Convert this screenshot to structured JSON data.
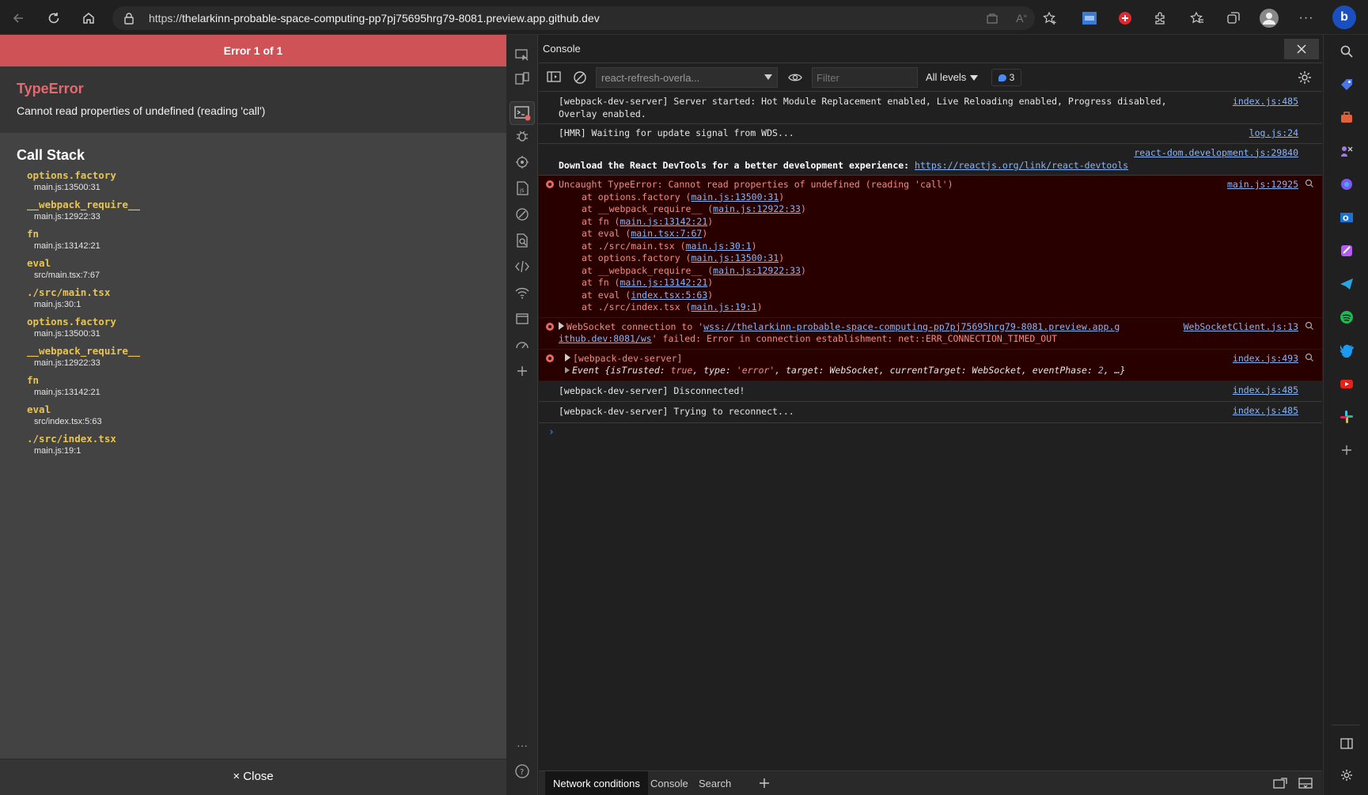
{
  "browser": {
    "url_scheme": "https://",
    "url_host": "thelarkinn-probable-space-computing-pp7pj75695hrg79-8081.preview.app.github.dev"
  },
  "overlay": {
    "banner": "Error 1 of 1",
    "error_title": "TypeError",
    "error_message": "Cannot read properties of undefined (reading 'call')",
    "call_stack_title": "Call Stack",
    "frames": [
      {
        "fn": "options.factory",
        "loc": "main.js:13500:31"
      },
      {
        "fn": "__webpack_require__",
        "loc": "main.js:12922:33"
      },
      {
        "fn": "fn",
        "loc": "main.js:13142:21"
      },
      {
        "fn": "eval",
        "loc": "src/main.tsx:7:67"
      },
      {
        "fn": "./src/main.tsx",
        "loc": "main.js:30:1"
      },
      {
        "fn": "options.factory",
        "loc": "main.js:13500:31"
      },
      {
        "fn": "__webpack_require__",
        "loc": "main.js:12922:33"
      },
      {
        "fn": "fn",
        "loc": "main.js:13142:21"
      },
      {
        "fn": "eval",
        "loc": "src/index.tsx:5:63"
      },
      {
        "fn": "./src/index.tsx",
        "loc": "main.js:19:1"
      }
    ],
    "close_label": "× Close"
  },
  "devtools": {
    "panel_title": "Console",
    "context": "react-refresh-overla...",
    "filter_placeholder": "Filter",
    "levels": "All levels",
    "issues_count": "3",
    "messages": [
      {
        "text1": "[webpack-dev-server] Server started: Hot Module Replacement enabled, Live Reloading enabled, Progress disabled,",
        "text2": "Overlay enabled.",
        "src": "index.js:485"
      },
      {
        "text": "[HMR] Waiting for update signal from WDS...",
        "src": "log.js:24"
      },
      {
        "src": "react-dom.development.js:29840",
        "text": "Download the React DevTools for a better development experience: ",
        "link": "https://reactjs.org/link/react-devtools"
      },
      {
        "text": "Uncaught TypeError: Cannot read properties of undefined (reading 'call')",
        "src": "main.js:12925",
        "stack": [
          {
            "pre": "at options.factory (",
            "link": "main.js:13500:31"
          },
          {
            "pre": "at __webpack_require__ (",
            "link": "main.js:12922:33"
          },
          {
            "pre": "at fn (",
            "link": "main.js:13142:21"
          },
          {
            "pre": "at eval (",
            "link": "main.tsx:7:67"
          },
          {
            "pre": "at ./src/main.tsx (",
            "link": "main.js:30:1"
          },
          {
            "pre": "at options.factory (",
            "link": "main.js:13500:31"
          },
          {
            "pre": "at __webpack_require__ (",
            "link": "main.js:12922:33"
          },
          {
            "pre": "at fn (",
            "link": "main.js:13142:21"
          },
          {
            "pre": "at eval (",
            "link": "index.tsx:5:63"
          },
          {
            "pre": "at ./src/index.tsx (",
            "link": "main.js:19:1"
          }
        ]
      },
      {
        "pre": "WebSocket connection to '",
        "link1": "wss://thelarkinn-probable-space-computing-pp7pj75695hrg79-8081.preview.app.g",
        "link2": "ithub.dev:8081/ws",
        "post": "' failed: Error in connection establishment: net::ERR_CONNECTION_TIMED_OUT",
        "src": "WebSocketClient.js:13"
      },
      {
        "text": "[webpack-dev-server]",
        "src": "index.js:493",
        "event_prefix": "Event {",
        "e1k": "isTrusted",
        "e1v": "true",
        "e2k": "type",
        "e2v": "'error'",
        "e3k": "target",
        "e3v": "WebSocket",
        "e4k": "currentTarget",
        "e4v": "WebSocket",
        "e5k": "eventPhase",
        "e5v": "2",
        "event_suffix": ", …}"
      },
      {
        "text": "[webpack-dev-server] Disconnected!",
        "src": "index.js:485"
      },
      {
        "text": "[webpack-dev-server] Trying to reconnect...",
        "src": "index.js:485"
      }
    ],
    "drawer_tabs": [
      "Network conditions",
      "Console",
      "Search"
    ]
  },
  "colors": {
    "banner_red": "#cf5257",
    "error_title": "#e36a6e",
    "stack_fn": "#e8c550",
    "link_blue": "#8ab4f8",
    "error_bg": "#290000"
  }
}
